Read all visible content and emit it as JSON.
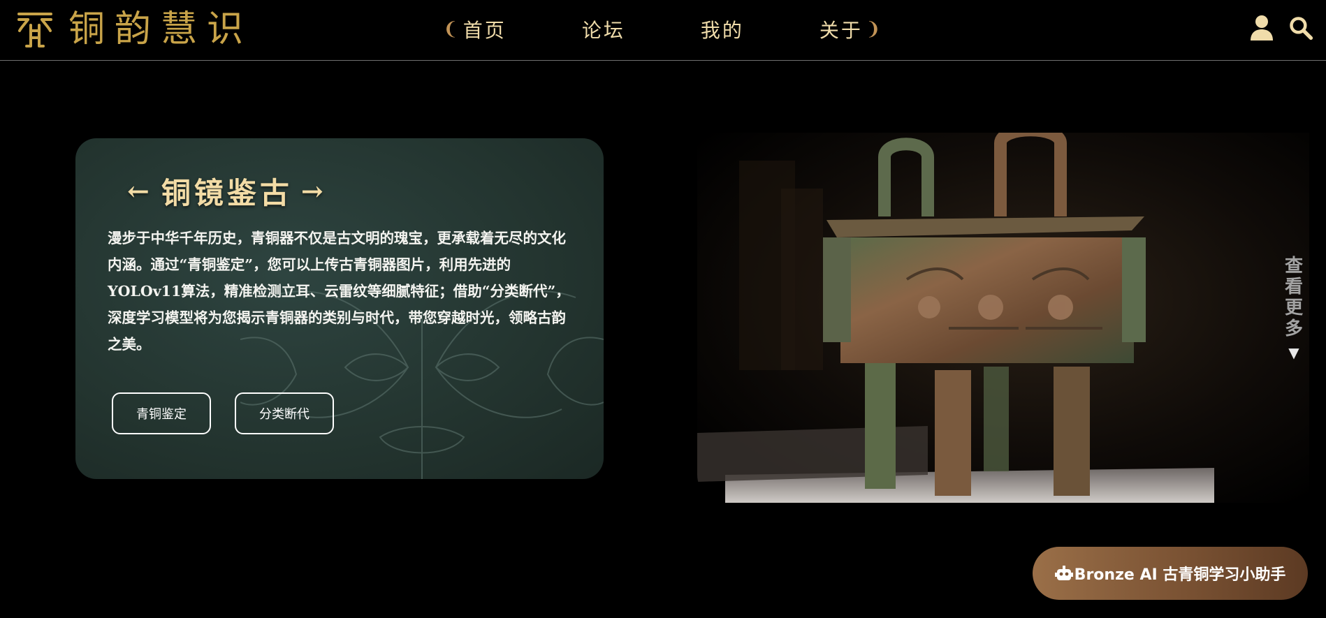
{
  "header": {
    "logo_text": "铜韵慧识",
    "nav": [
      {
        "label": "首页"
      },
      {
        "label": "论坛"
      },
      {
        "label": "我的"
      },
      {
        "label": "关于"
      }
    ],
    "icons": [
      "user-icon",
      "search-icon"
    ],
    "accent_color": "#c9a449"
  },
  "card": {
    "left_arrow": "←",
    "title": "铜镜鉴古",
    "right_arrow": "→",
    "description": "漫步于中华千年历史，青铜器不仅是古文明的瑰宝，更承载着无尽的文化内涵。通过“青铜鉴定”，您可以上传古青铜器图片，利用先进的YOLOv11算法，精准检测立耳、云雷纹等细腻特征；借助“分类断代”，深度学习模型将为您揭示青铜器的类别与时代，带您穿越时光，领略古韵之美。",
    "button_identify": "青铜鉴定",
    "button_classify": "分类断代"
  },
  "see_more": {
    "label": "查看更多",
    "arrow": "▼"
  },
  "assistant": {
    "label": "Bronze AI 古青铜学习小助手",
    "icon": "robot-icon"
  }
}
